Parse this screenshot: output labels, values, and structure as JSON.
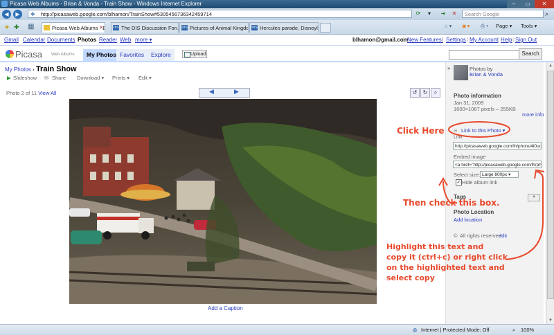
{
  "window": {
    "title": "Picasa Web Albums - Brian & Vonda - Train Show - Windows Internet Explorer",
    "controls": {
      "minimize": "–",
      "maximize": "▭",
      "close": "✕"
    }
  },
  "address": {
    "url": "http://picasaweb.google.com/blhamon/TrainShow#5305456736342459714",
    "search_placeholder": "Search Google"
  },
  "tabs": [
    {
      "label": "Picasa Web Albums - B...",
      "active": true
    },
    {
      "label": "The DIS Discussion Forum...",
      "active": false
    },
    {
      "label": "Pictures of Animal Kingdo...",
      "active": false
    },
    {
      "label": "Hercules parade, Disneyla...",
      "active": false
    }
  ],
  "ie_commands": {
    "page": "Page ▾",
    "tools": "Tools ▾"
  },
  "google_bar": {
    "links": [
      "Gmail",
      "Calendar",
      "Documents",
      "Photos",
      "Reader",
      "Web",
      "more ▾"
    ],
    "current": "Photos",
    "email": "blhamon@gmail.com",
    "right_links": [
      "New Features!",
      "Settings",
      "My Account",
      "Help",
      "Sign Out"
    ]
  },
  "picasa": {
    "logo": "Picasa",
    "logo_sub": "Web Albums",
    "nav_tabs": [
      "My Photos",
      "Favorites",
      "Explore"
    ],
    "active_tab": "My Photos",
    "upload": "Upload",
    "search_button": "Search"
  },
  "breadcrumb": {
    "parent": "My Photos",
    "separator": "›",
    "title": "Train Show"
  },
  "toolbar": {
    "slideshow": "Slideshow",
    "share": "Share",
    "download": "Download ▾",
    "prints": "Prints ▾",
    "edit": "Edit ▾"
  },
  "photo_nav": {
    "position": "Photo 2 of 11",
    "view_all": "View All"
  },
  "caption_link": "Add a Caption",
  "sidebar": {
    "photos_by": "Photos by",
    "owner": "Brian & Vonda",
    "info_heading": "Photo information",
    "date": "Jan 31, 2009",
    "dimensions": "1600×1067 pixels – 255KB",
    "more_info": "more info",
    "link_to_photo": "Link to this Photo ▾",
    "link_label": "Link",
    "link_value": "http://picasaweb.google.com/lh/photo/4t0ude",
    "embed_label": "Embed image",
    "embed_value": "<a href=\"http://picasaweb.google.com/lh/photo",
    "select_size_label": "Select size:",
    "select_size_value": "Large 800px ▾",
    "hide_album_link": "Hide album link",
    "tags_heading": "Tags",
    "tag_add_button": "+",
    "location_heading": "Photo Location",
    "add_location": "Add location",
    "rights": "All rights reserved",
    "rights_edit": "edit"
  },
  "annotations": {
    "click_here": "Click Here",
    "check_box": "Then check this box.",
    "highlight_lines": [
      "Highlight this text and",
      "copy it (ctrl+c) or right click",
      "on the highlighted text and",
      "select copy"
    ],
    "color": "#e8492c"
  },
  "statusbar": {
    "zone": "Internet | Protected Mode: Off",
    "zoom": "100%"
  }
}
